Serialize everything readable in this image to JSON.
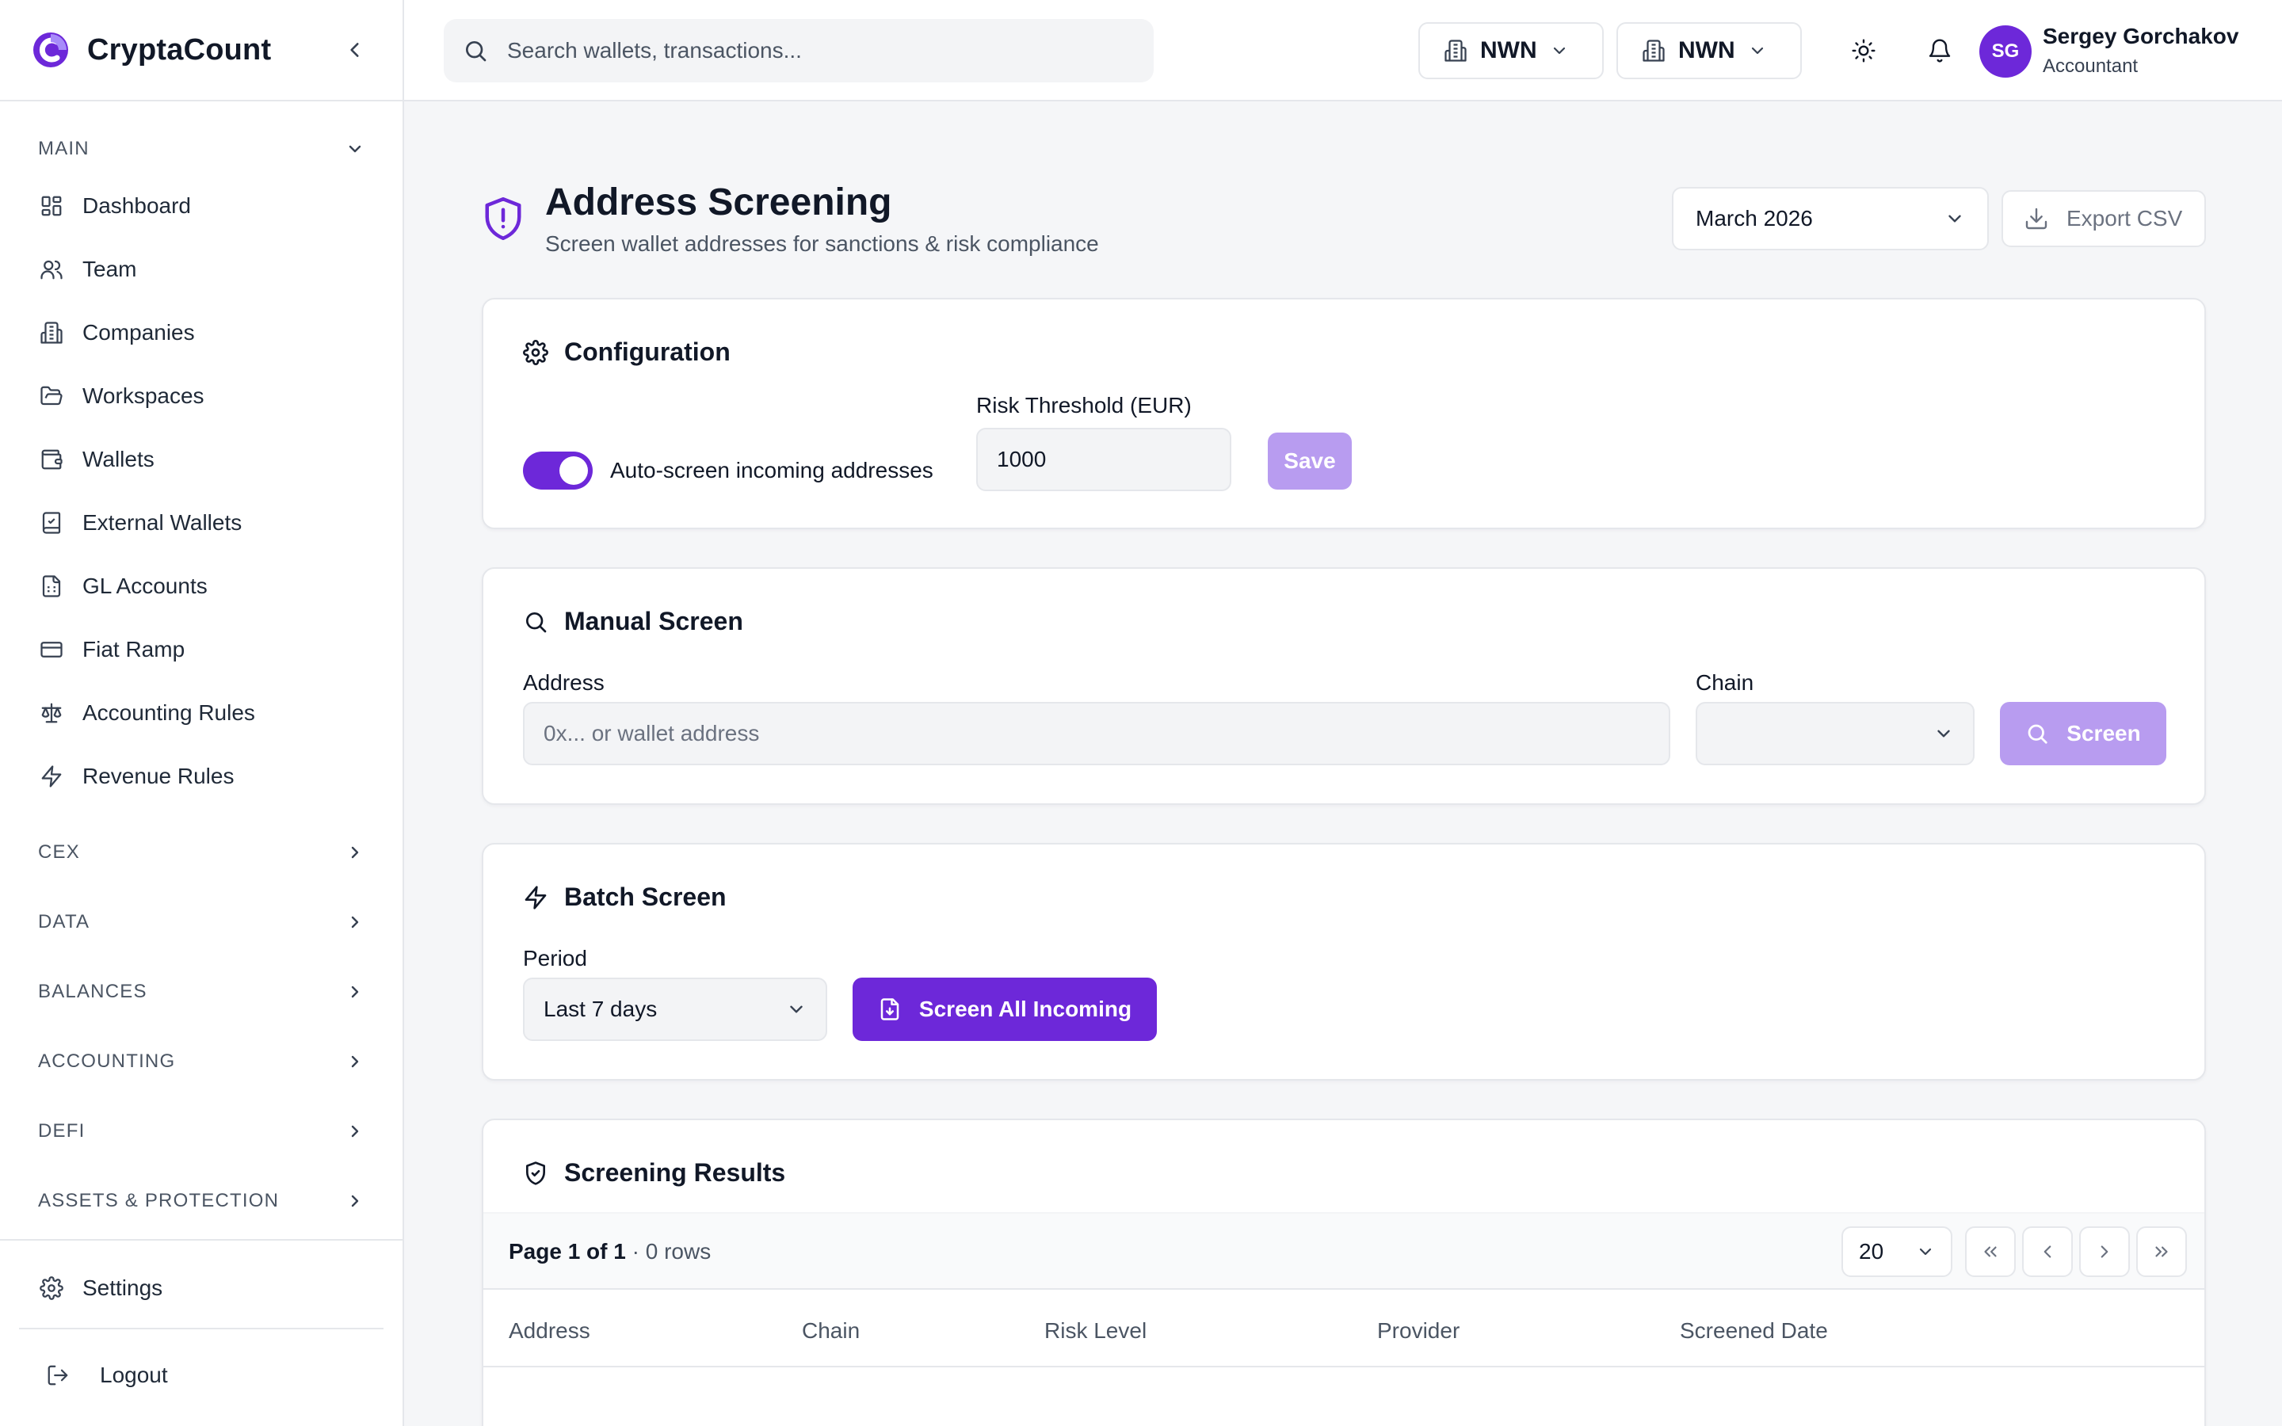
{
  "app": {
    "name": "CryptaCount"
  },
  "sidebar": {
    "sections": {
      "main": "MAIN",
      "cex": "CEX",
      "data": "DATA",
      "balances": "BALANCES",
      "accounting": "ACCOUNTING",
      "defi": "DEFI",
      "assets": "ASSETS & PROTECTION"
    },
    "items": [
      {
        "label": "Dashboard",
        "icon": "grid-icon"
      },
      {
        "label": "Team",
        "icon": "users-icon"
      },
      {
        "label": "Companies",
        "icon": "building-icon"
      },
      {
        "label": "Workspaces",
        "icon": "folder-open-icon"
      },
      {
        "label": "Wallets",
        "icon": "wallet-icon"
      },
      {
        "label": "External Wallets",
        "icon": "book-icon"
      },
      {
        "label": "GL Accounts",
        "icon": "file-spreadsheet-icon"
      },
      {
        "label": "Fiat Ramp",
        "icon": "credit-card-icon"
      },
      {
        "label": "Accounting Rules",
        "icon": "scale-icon"
      },
      {
        "label": "Revenue Rules",
        "icon": "zap-icon"
      }
    ],
    "settings": "Settings",
    "logout": "Logout"
  },
  "topbar": {
    "search_placeholder": "Search wallets, transactions...",
    "org1": "NWN",
    "org2": "NWN",
    "user": {
      "initials": "SG",
      "name": "Sergey Gorchakov",
      "role": "Accountant"
    }
  },
  "page": {
    "title": "Address Screening",
    "subtitle": "Screen wallet addresses for sanctions & risk compliance",
    "month": "March 2026",
    "export_label": "Export CSV"
  },
  "config": {
    "title": "Configuration",
    "toggle_label": "Auto-screen incoming addresses",
    "toggle_on": true,
    "threshold_label": "Risk Threshold (EUR)",
    "threshold_value": "1000",
    "save_label": "Save"
  },
  "manual": {
    "title": "Manual Screen",
    "address_label": "Address",
    "address_placeholder": "0x... or wallet address",
    "chain_label": "Chain",
    "chain_value": "",
    "screen_label": "Screen"
  },
  "batch": {
    "title": "Batch Screen",
    "period_label": "Period",
    "period_value": "Last 7 days",
    "button_label": "Screen All Incoming"
  },
  "results": {
    "title": "Screening Results",
    "page_text": "Page 1 of 1",
    "rows_text": " · 0 rows",
    "page_size": "20",
    "columns": [
      "Address",
      "Chain",
      "Risk Level",
      "Provider",
      "Screened Date"
    ]
  },
  "colors": {
    "accent": "#6d28d9",
    "accent_disabled": "#b89cf0"
  }
}
